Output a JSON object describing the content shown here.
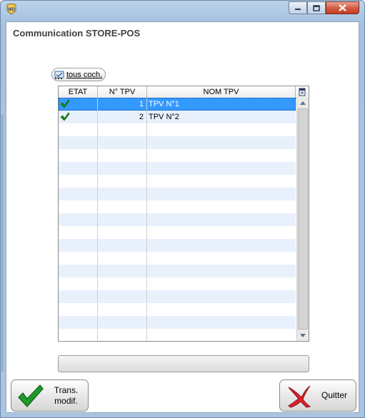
{
  "window": {
    "title": ""
  },
  "page": {
    "title": "Communication STORE-POS"
  },
  "toolbar": {
    "check_all_label": "tous coch."
  },
  "table": {
    "columns": [
      "ETAT",
      "N° TPV",
      "NOM TPV"
    ],
    "rows": [
      {
        "etat": "checked",
        "num": "1",
        "nom": "TPV N°1",
        "selected": true
      },
      {
        "etat": "checked",
        "num": "2",
        "nom": "TPV N°2",
        "selected": false
      }
    ]
  },
  "buttons": {
    "trans_line1": "Trans.",
    "trans_line2": "modif.",
    "quit": "Quitter"
  },
  "icons": {
    "app": "windev-icon",
    "check": "green-check-icon",
    "quit": "red-x-icon",
    "column_menu": "column-menu-icon"
  },
  "colors": {
    "selection": "#3399ff",
    "alt_row": "#e8f1fb",
    "check_green": "#1a8a1a",
    "quit_red": "#d41b1b"
  }
}
